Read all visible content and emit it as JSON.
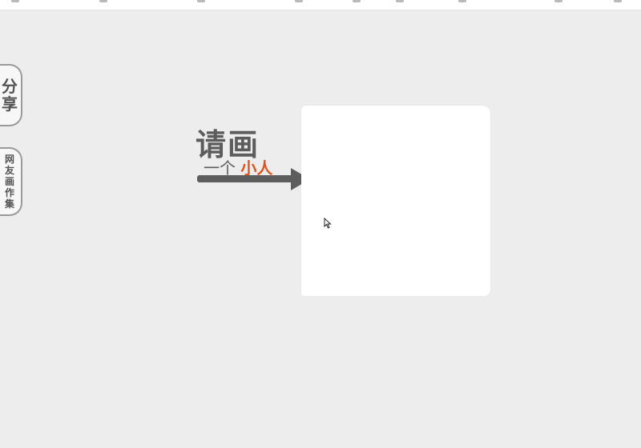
{
  "side_tabs": {
    "share": {
      "chars": [
        "分",
        "享"
      ]
    },
    "gallery": {
      "chars": [
        "网",
        "友",
        "画",
        "作",
        "集"
      ]
    }
  },
  "prompt": {
    "line1": "请画",
    "line2_prefix": "一个",
    "line2_accent": "小人"
  },
  "colors": {
    "background": "#ededed",
    "text": "#5c5c5c",
    "accent": "#e0531c",
    "canvas": "#ffffff"
  }
}
